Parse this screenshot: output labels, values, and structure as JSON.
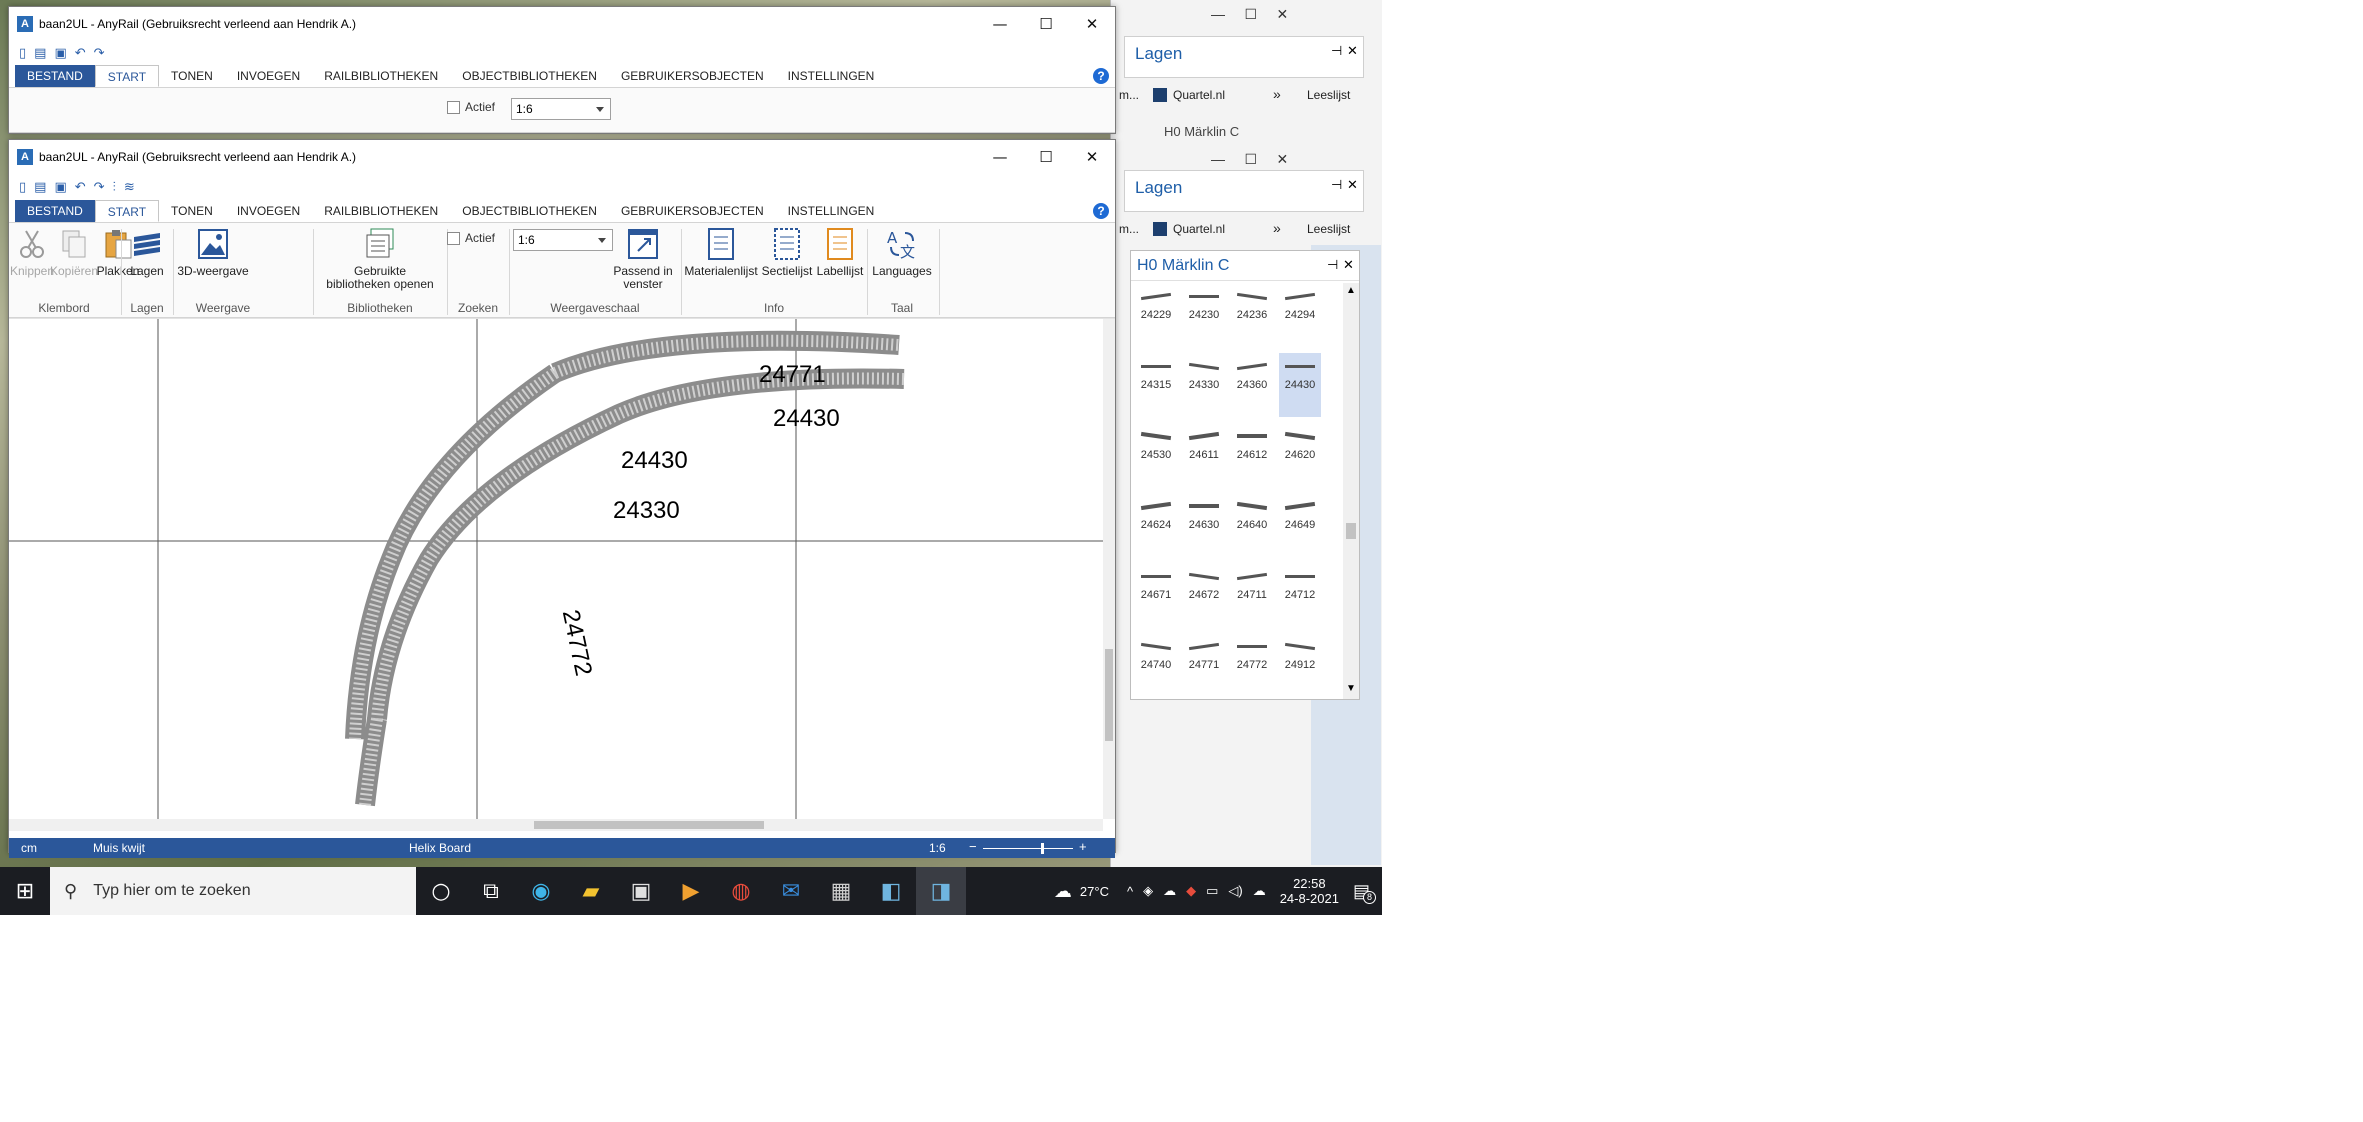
{
  "app_title": "baan2UL - AnyRail (Gebruiksrecht verleend aan Hendrik A.)",
  "ribbon_tabs": [
    "BESTAND",
    "START",
    "TONEN",
    "INVOEGEN",
    "RAILBIBLIOTHEKEN",
    "OBJECTBIBLIOTHEKEN",
    "GEBRUIKERSOBJECTEN",
    "INSTELLINGEN"
  ],
  "help": "?",
  "ribbon": {
    "knippen": "Knippen",
    "kopieren": "Kopiëren",
    "plakken": "Plakken",
    "lagen": "Lagen",
    "weergave3d": "3D-weergave",
    "bibliotheken_line1": "Gebruikte",
    "bibliotheken_line2": "bibliotheken openen",
    "actief": "Actief",
    "scale": "1:6",
    "passend_line1": "Passend in",
    "passend_line2": "venster",
    "materiaal": "Materialenlijst",
    "sectie": "Sectielijst",
    "label": "Labellijst",
    "languages": "Languages"
  },
  "groups": {
    "klembord": "Klembord",
    "lagen": "Lagen",
    "weergave": "Weergave",
    "bibliotheken": "Bibliotheken",
    "zoeken": "Zoeken",
    "weergaveschaal": "Weergaveschaal",
    "info": "Info",
    "taal": "Taal"
  },
  "track_labels": [
    "24771",
    "24430",
    "24430",
    "24330",
    "24772"
  ],
  "statusbar": {
    "unit": "cm",
    "mouse": "Muis kwijt",
    "board": "Helix Board",
    "zoom": "1:6"
  },
  "background_panel": {
    "title": "Lagen",
    "bookmark_partial": "m...",
    "bookmark_quartel": "Quartel.nl",
    "more": "»",
    "leeslijst": "Leeslijst",
    "partial_title": "H0 Märklin C"
  },
  "library": {
    "title": "H0 Märklin C",
    "tiles": [
      "24229",
      "24230",
      "24236",
      "24294",
      "24315",
      "24330",
      "24360",
      "24430",
      "24530",
      "24611",
      "24612",
      "24620",
      "24624",
      "24630",
      "24640",
      "24649",
      "24671",
      "24672",
      "24711",
      "24712",
      "24740",
      "24771",
      "24772",
      "24912"
    ],
    "selected": "24430"
  },
  "taskbar": {
    "search_placeholder": "Typ hier om te zoeken",
    "temperature": "27°C",
    "time": "22:58",
    "date": "24-8-2021",
    "notifications": "8"
  }
}
